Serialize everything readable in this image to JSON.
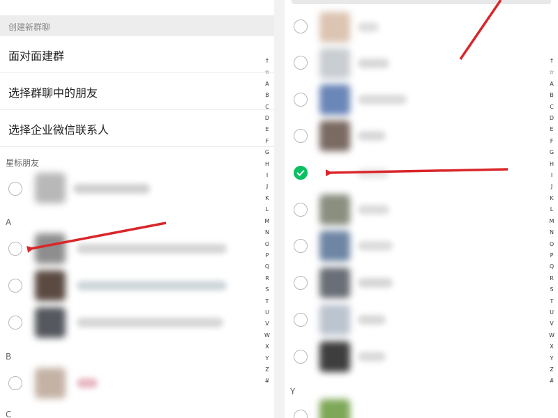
{
  "left": {
    "header": "创建新群聊",
    "options": [
      {
        "label": "面对面建群"
      },
      {
        "label": "选择群聊中的朋友"
      },
      {
        "label": "选择企业微信联系人"
      }
    ],
    "sections": {
      "starred": "星标朋友",
      "a": "A",
      "b": "B",
      "c": "C"
    }
  },
  "right": {
    "sections": {
      "y": "Y"
    }
  },
  "index_letters": [
    "↑",
    "☆",
    "A",
    "B",
    "C",
    "D",
    "E",
    "F",
    "G",
    "H",
    "I",
    "J",
    "K",
    "L",
    "M",
    "N",
    "O",
    "P",
    "Q",
    "R",
    "S",
    "T",
    "U",
    "V",
    "W",
    "X",
    "Y",
    "Z",
    "#"
  ],
  "colors": {
    "check": "#07c160",
    "arrow": "#d9262a"
  },
  "icons": {
    "checked": "checkmark-icon",
    "unchecked": "radio-circle-icon",
    "alpha_index": "alphabet-index"
  }
}
